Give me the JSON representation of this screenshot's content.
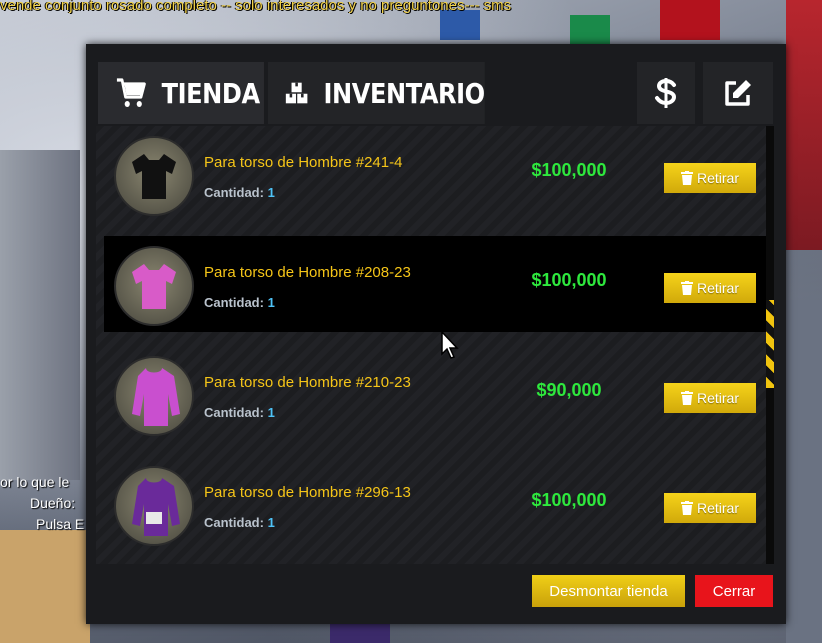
{
  "chat": {
    "message": "vende conjunto rosado completo -- solo interesados y no preguntones--- sms"
  },
  "background_text": {
    "line1": "or lo que le",
    "line2": "Dueño:",
    "line3": "Pulsa E"
  },
  "tabs": [
    {
      "label": "TIENDA",
      "icon": "shopping-cart-icon",
      "active": true
    },
    {
      "label": "INVENTARIO",
      "icon": "boxes-icon",
      "active": false
    }
  ],
  "actions": {
    "money_icon": "dollar-icon",
    "edit_icon": "edit-icon"
  },
  "items": [
    {
      "name": "Para torso de Hombre #241-4",
      "qty_label": "Cantidad:",
      "qty": "1",
      "price": "$100,000",
      "button": "Retirar",
      "color": "#111111"
    },
    {
      "name": "Para torso de Hombre #208-23",
      "qty_label": "Cantidad:",
      "qty": "1",
      "price": "$100,000",
      "button": "Retirar",
      "color": "#d85bc8"
    },
    {
      "name": "Para torso de Hombre #210-23",
      "qty_label": "Cantidad:",
      "qty": "1",
      "price": "$90,000",
      "button": "Retirar",
      "color": "#c94fcf"
    },
    {
      "name": "Para torso de Hombre #296-13",
      "qty_label": "Cantidad:",
      "qty": "1",
      "price": "$100,000",
      "button": "Retirar",
      "color": "#6a2a9a"
    }
  ],
  "footer": {
    "dismantle": "Desmontar tienda",
    "close": "Cerrar"
  },
  "colors": {
    "accent_yellow": "#f5c518",
    "price_green": "#2ee83d",
    "qty_blue": "#4fc3f7",
    "close_red": "#e8141b"
  }
}
